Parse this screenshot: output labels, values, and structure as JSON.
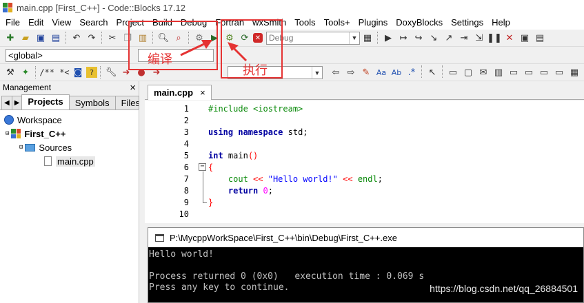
{
  "window": {
    "title": "main.cpp [First_C++] - Code::Blocks 17.12"
  },
  "menu": [
    "File",
    "Edit",
    "View",
    "Search",
    "Project",
    "Build",
    "Debug",
    "Fortran",
    "wxSmith",
    "Tools",
    "Tools+",
    "Plugins",
    "DoxyBlocks",
    "Settings",
    "Help"
  ],
  "toolbar": {
    "build_target": "Debug",
    "scope": "<global>",
    "comment_btn": "/** *<"
  },
  "management": {
    "title": "Management",
    "close": "×",
    "tabs": [
      "Projects",
      "Symbols",
      "Files"
    ],
    "tree": {
      "workspace": "Workspace",
      "project": "First_C++",
      "folder": "Sources",
      "file": "main.cpp"
    }
  },
  "editor": {
    "tab": "main.cpp",
    "tab_close": "×",
    "line_numbers": [
      "1",
      "2",
      "3",
      "4",
      "5",
      "6",
      "7",
      "8",
      "9",
      "10"
    ]
  },
  "console": {
    "title": "P:\\MycppWorkSpace\\First_C++\\bin\\Debug\\First_C++.exe",
    "line1": "Hello world!",
    "line2": "Process returned 0 (0x0)   execution time : 0.069 s",
    "line3": "Press any key to continue."
  },
  "watermark": "https://blog.csdn.net/qq_26884501",
  "annotations": {
    "compile": "编译",
    "run": "执行"
  },
  "colors": {
    "annotation": "#e53333",
    "keyword": "#0000a0",
    "preprocessor": "#0a8a0a",
    "string": "#0000ff",
    "number": "#ff00ff"
  }
}
